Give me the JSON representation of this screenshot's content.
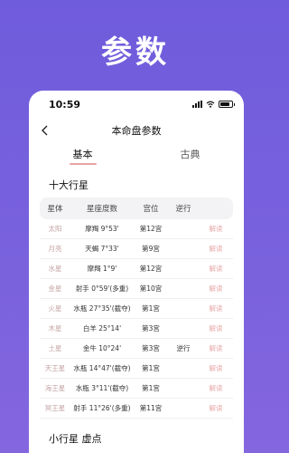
{
  "hero": {
    "title": "参数"
  },
  "status": {
    "time": "10:59"
  },
  "nav": {
    "title": "本命盘参数"
  },
  "tabs": [
    {
      "label": "基本",
      "active": true
    },
    {
      "label": "古典",
      "active": false
    }
  ],
  "section_major": {
    "title": "十大行星"
  },
  "table": {
    "headers": [
      "星体",
      "星座度数",
      "宫位",
      "逆行",
      ""
    ],
    "rows": [
      {
        "planet": "太阳",
        "sign": "摩羯 9°53'",
        "house": "第12宫",
        "retro": "",
        "action": "解读"
      },
      {
        "planet": "月亮",
        "sign": "天蝎 7°33'",
        "house": "第9宫",
        "retro": "",
        "action": "解读"
      },
      {
        "planet": "水星",
        "sign": "摩羯 1°9'",
        "house": "第12宫",
        "retro": "",
        "action": "解读"
      },
      {
        "planet": "金星",
        "sign": "射手 0°59'(多重)",
        "house": "第10宫",
        "retro": "",
        "action": "解读"
      },
      {
        "planet": "火星",
        "sign": "水瓶 27°35'(截夺)",
        "house": "第1宫",
        "retro": "",
        "action": "解读"
      },
      {
        "planet": "木星",
        "sign": "白羊 25°14'",
        "house": "第3宫",
        "retro": "",
        "action": "解读"
      },
      {
        "planet": "土星",
        "sign": "金牛 10°24'",
        "house": "第3宫",
        "retro": "逆行",
        "action": "解读"
      },
      {
        "planet": "天王星",
        "sign": "水瓶 14°47'(截夺)",
        "house": "第1宫",
        "retro": "",
        "action": "解读"
      },
      {
        "planet": "海王星",
        "sign": "水瓶 3°11'(截夺)",
        "house": "第1宫",
        "retro": "",
        "action": "解读"
      },
      {
        "planet": "冥王星",
        "sign": "射手 11°26'(多重)",
        "house": "第11宫",
        "retro": "",
        "action": "解读"
      }
    ]
  },
  "section_minor": {
    "title": "小行星 虚点"
  },
  "colors": {
    "background": "#7a62dd",
    "accent": "#e7a7a7",
    "planet": "#c6a5a5"
  },
  "icons": {
    "back": "chevron-left-icon"
  }
}
